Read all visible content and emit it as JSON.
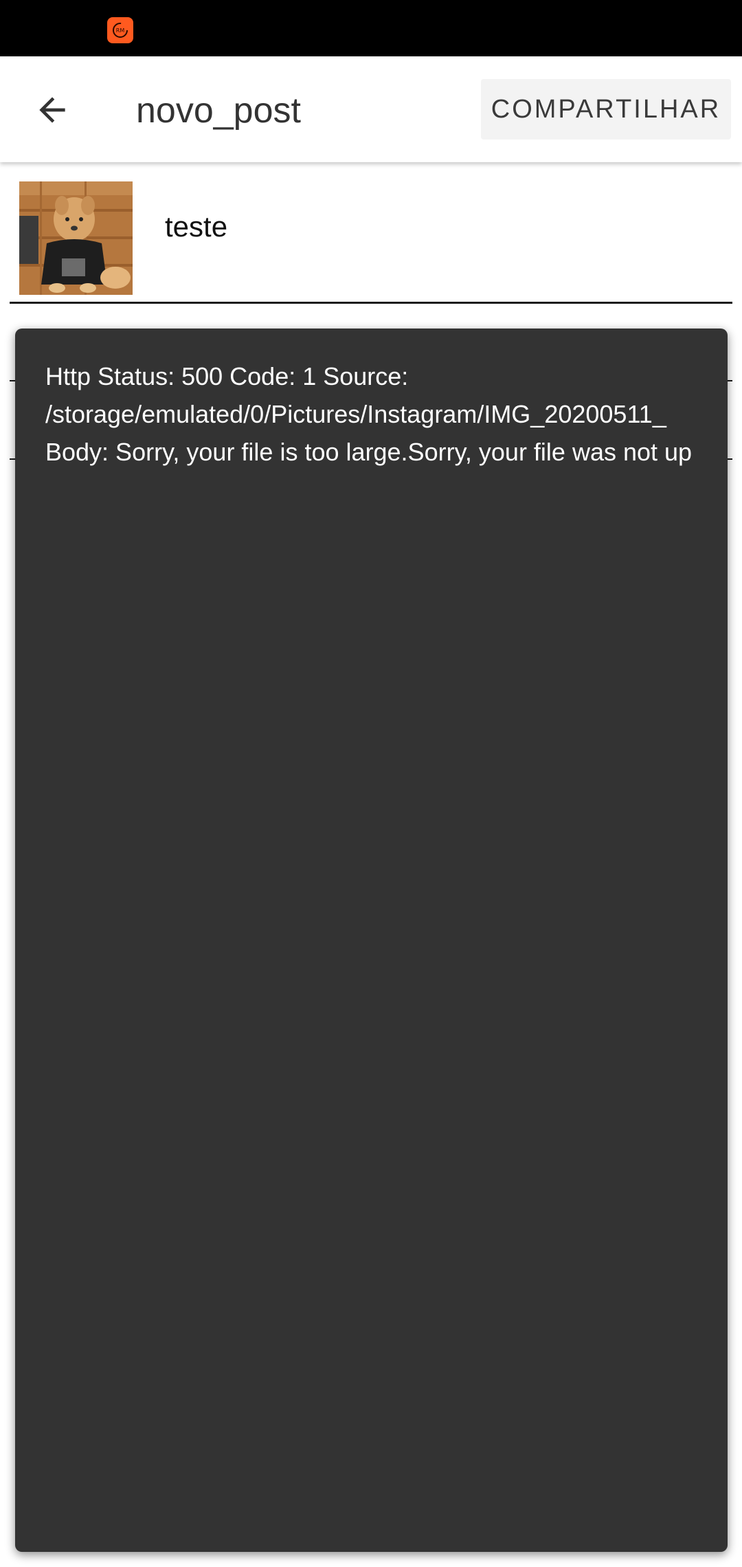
{
  "status_bar": {
    "notification_icon": "screen-recorder-icon",
    "accent_color": "#ff5a1f"
  },
  "app_bar": {
    "back_icon": "arrow-left-icon",
    "title": "novo_post",
    "share_label": "COMPARTILHAR"
  },
  "post": {
    "thumbnail_icon": "photo-thumbnail",
    "caption": "teste"
  },
  "toast": {
    "lines": [
      "Http Status: 500 Code: 1 Source:",
      "/storage/emulated/0/Pictures/Instagram/IMG_20200511_",
      "Body: Sorry, your file is too large.Sorry, your file was not up"
    ],
    "background": "#333333"
  }
}
